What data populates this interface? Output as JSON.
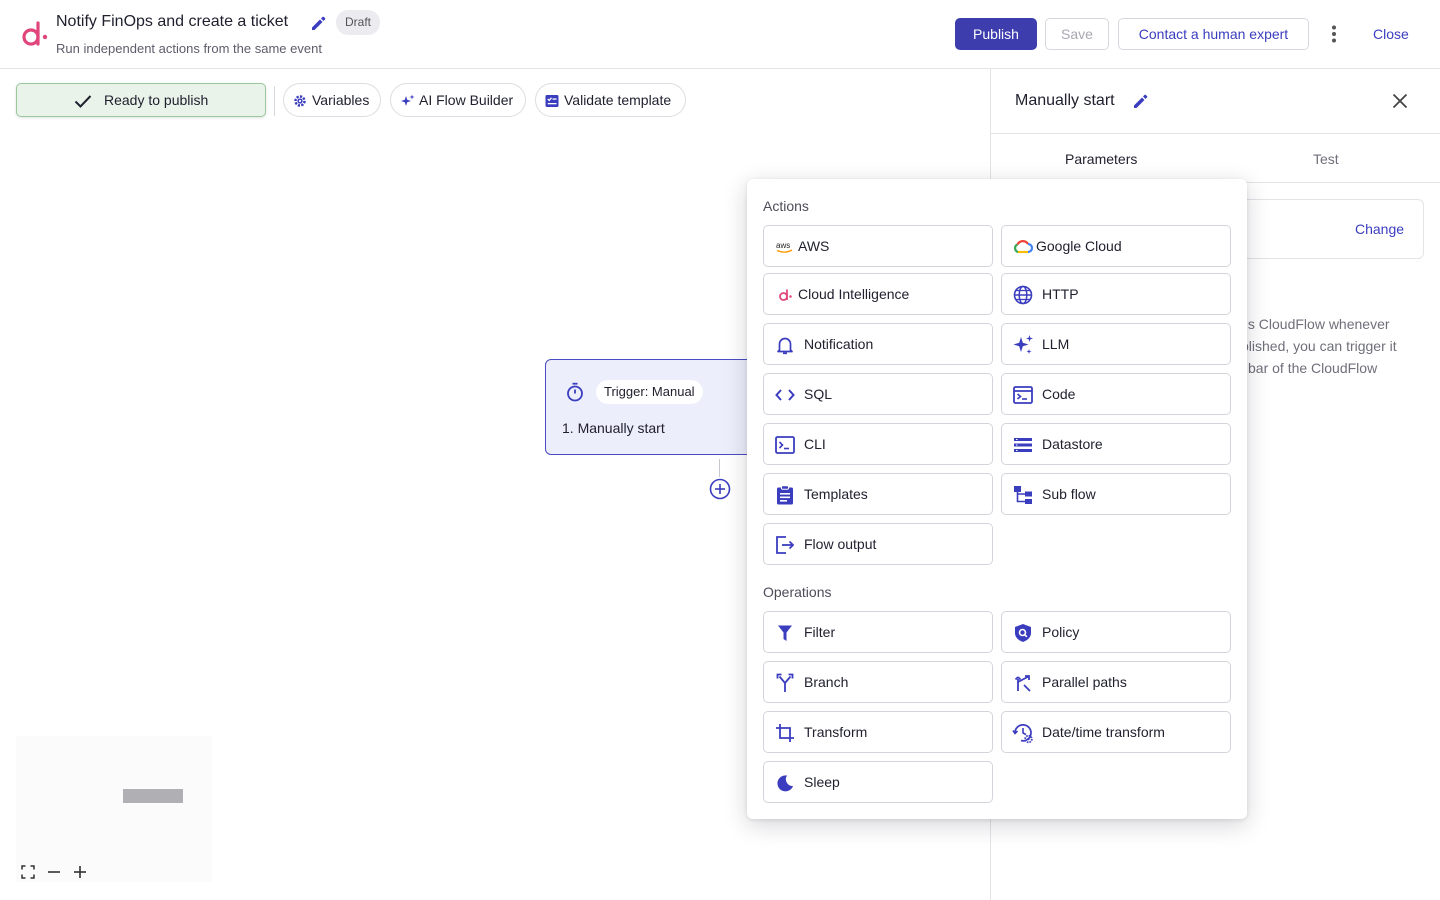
{
  "header": {
    "title": "Notify FinOps and create a ticket",
    "status_badge": "Draft",
    "subtitle": "Run independent actions from the same event",
    "publish_label": "Publish",
    "save_label": "Save",
    "expert_label": "Contact a human expert",
    "close_label": "Close"
  },
  "toolbar": {
    "ready_label": "Ready to publish",
    "variables_label": "Variables",
    "ai_builder_label": "AI Flow Builder",
    "validate_label": "Validate template"
  },
  "canvas": {
    "node": {
      "trigger_badge": "Trigger: Manual",
      "label": "1. Manually start"
    }
  },
  "right_panel": {
    "title": "Manually start",
    "tabs": [
      "Parameters",
      "Test"
    ],
    "change_label": "Change",
    "description_lines": [
      "his CloudFlow whenever",
      "blished, you can trigger it",
      "bar of the CloudFlow"
    ]
  },
  "popover": {
    "actions_heading": "Actions",
    "operations_heading": "Operations",
    "actions": [
      {
        "label": "AWS",
        "icon": "aws-icon"
      },
      {
        "label": "Google Cloud",
        "icon": "google-cloud-icon"
      },
      {
        "label": "Cloud Intelligence",
        "icon": "cloud-intelligence-icon"
      },
      {
        "label": "HTTP",
        "icon": "globe-icon"
      },
      {
        "label": "Notification",
        "icon": "bell-icon"
      },
      {
        "label": "LLM",
        "icon": "sparkles-icon"
      },
      {
        "label": "SQL",
        "icon": "code-brackets-icon"
      },
      {
        "label": "Code",
        "icon": "terminal-window-icon"
      },
      {
        "label": "CLI",
        "icon": "terminal-icon"
      },
      {
        "label": "Datastore",
        "icon": "list-icon"
      },
      {
        "label": "Templates",
        "icon": "clipboard-icon"
      },
      {
        "label": "Sub flow",
        "icon": "sub-flow-icon"
      },
      {
        "label": "Flow output",
        "icon": "exit-icon"
      }
    ],
    "operations": [
      {
        "label": "Filter",
        "icon": "filter-icon"
      },
      {
        "label": "Policy",
        "icon": "shield-search-icon"
      },
      {
        "label": "Branch",
        "icon": "branch-icon"
      },
      {
        "label": "Parallel paths",
        "icon": "parallel-paths-icon"
      },
      {
        "label": "Transform",
        "icon": "crop-icon"
      },
      {
        "label": "Date/time transform",
        "icon": "date-time-icon"
      },
      {
        "label": "Sleep",
        "icon": "moon-icon"
      }
    ]
  },
  "colors": {
    "accent": "#3b3dbf",
    "publish_bg": "#3d3dae",
    "ready_bg": "#e9f3e9",
    "brand": "#e0457b"
  }
}
